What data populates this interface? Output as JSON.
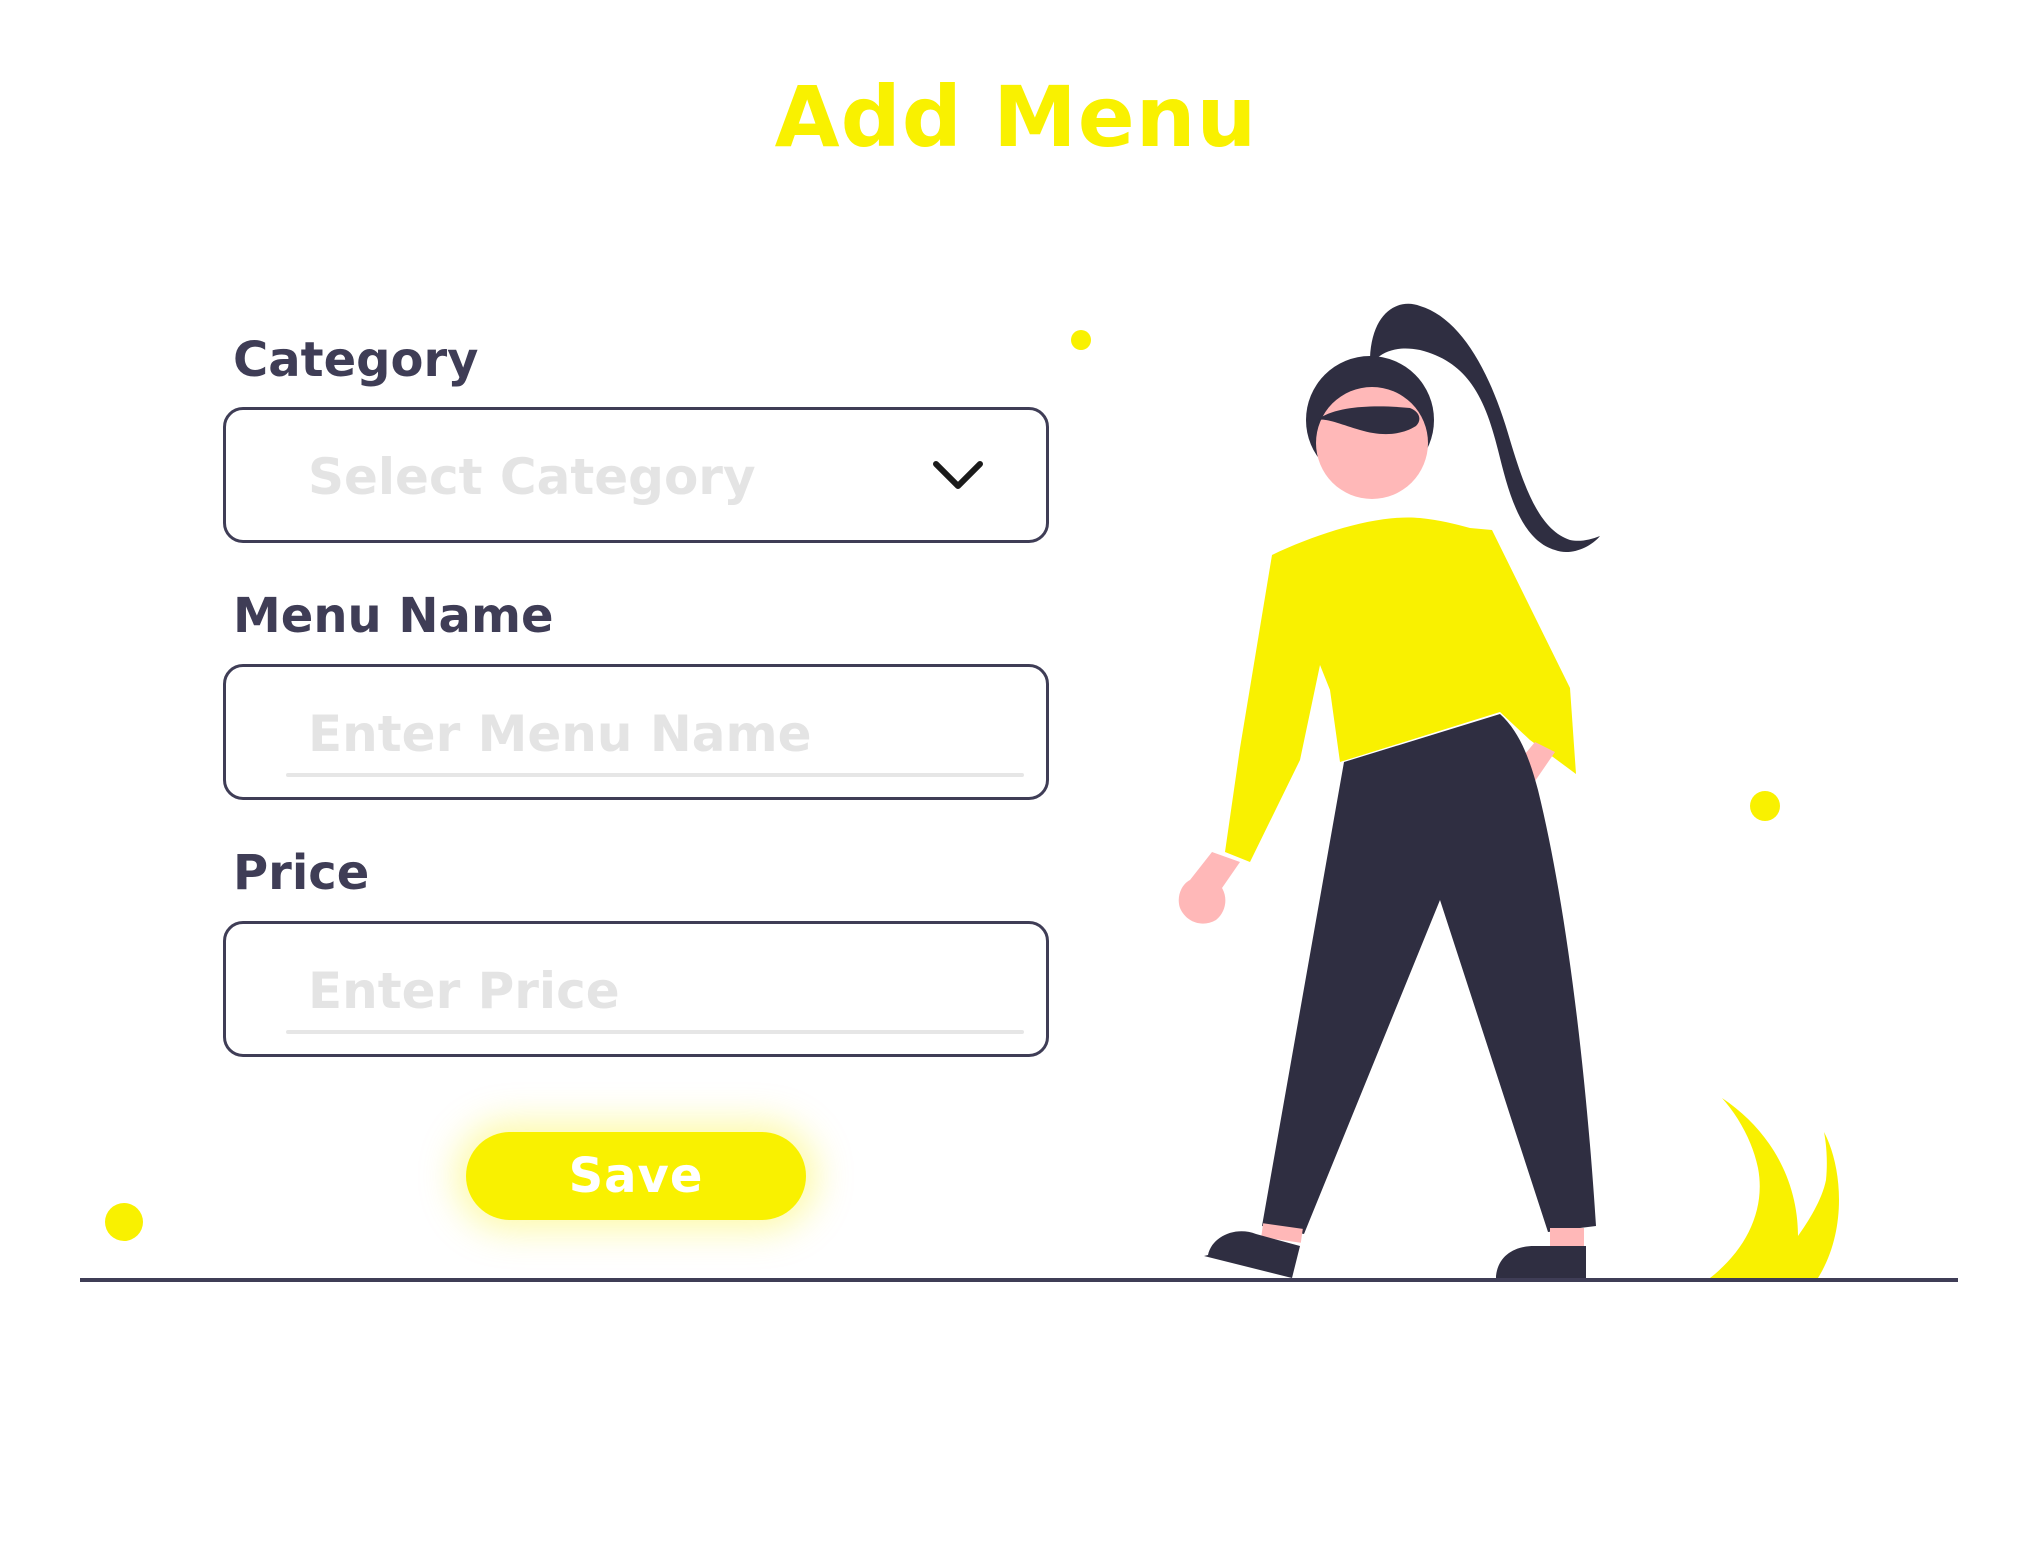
{
  "page": {
    "title": "Add Menu"
  },
  "form": {
    "category": {
      "label": "Category",
      "placeholder": "Select Category",
      "icon": "chevron-down-icon"
    },
    "menu_name": {
      "label": "Menu Name",
      "placeholder": "Enter Menu Name"
    },
    "price": {
      "label": "Price",
      "placeholder": "Enter Price"
    },
    "save_label": "Save"
  },
  "colors": {
    "accent": "#F9F100",
    "text_dark": "#3F3D56",
    "placeholder": "#E4E4E4",
    "skin": "#FFB8B8",
    "hair_pants": "#2F2E41"
  }
}
